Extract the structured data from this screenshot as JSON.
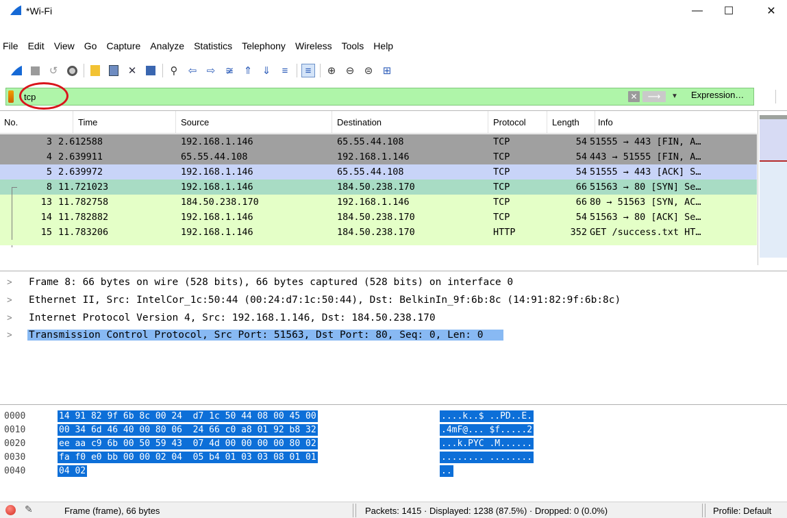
{
  "window": {
    "title": "*Wi-Fi",
    "minimize": "—",
    "maximize": "☐",
    "close": "✕"
  },
  "menu": [
    "File",
    "Edit",
    "View",
    "Go",
    "Capture",
    "Analyze",
    "Statistics",
    "Telephony",
    "Wireless",
    "Tools",
    "Help"
  ],
  "toolbar": {
    "icons": [
      "shark-fin-icon",
      "stop-icon",
      "restart-icon",
      "capture-options-icon",
      "open-file-icon",
      "save-file-icon",
      "close-file-icon",
      "reload-icon",
      "find-packet-icon",
      "go-back-icon",
      "go-forward-icon",
      "go-to-packet-icon",
      "go-first-icon",
      "go-last-icon",
      "autoscroll-icon",
      "colorize-icon",
      "zoom-in-icon",
      "zoom-out-icon",
      "zoom-normal-icon",
      "resize-columns-icon"
    ]
  },
  "filter": {
    "value": "tcp",
    "expression_label": "Expression…",
    "clear_label": "✕",
    "apply_label": "⟶"
  },
  "packet_list": {
    "columns": [
      "No.",
      "Time",
      "Source",
      "Destination",
      "Protocol",
      "Length",
      "Info"
    ],
    "rows": [
      {
        "no": "3",
        "time": "2.612588",
        "src": "192.168.1.146",
        "dst": "65.55.44.108",
        "proto": "TCP",
        "len": "54",
        "info": "51555 → 443 [FIN, A…",
        "bg": "#a0a0a0"
      },
      {
        "no": "4",
        "time": "2.639911",
        "src": "65.55.44.108",
        "dst": "192.168.1.146",
        "proto": "TCP",
        "len": "54",
        "info": "443 → 51555 [FIN, A…",
        "bg": "#a0a0a0"
      },
      {
        "no": "5",
        "time": "2.639972",
        "src": "192.168.1.146",
        "dst": "65.55.44.108",
        "proto": "TCP",
        "len": "54",
        "info": "51555 → 443 [ACK] S…",
        "bg": "#c8d4f8"
      },
      {
        "no": "8",
        "time": "11.721023",
        "src": "192.168.1.146",
        "dst": "184.50.238.170",
        "proto": "TCP",
        "len": "66",
        "info": "51563 → 80 [SYN] Se…",
        "bg": "#a8dcc4"
      },
      {
        "no": "13",
        "time": "11.782758",
        "src": "184.50.238.170",
        "dst": "192.168.1.146",
        "proto": "TCP",
        "len": "66",
        "info": "80 → 51563 [SYN, AC…",
        "bg": "#e4ffc7"
      },
      {
        "no": "14",
        "time": "11.782882",
        "src": "192.168.1.146",
        "dst": "184.50.238.170",
        "proto": "TCP",
        "len": "54",
        "info": "51563 → 80 [ACK] Se…",
        "bg": "#e4ffc7"
      },
      {
        "no": "15",
        "time": "11.783206",
        "src": "192.168.1.146",
        "dst": "184.50.238.170",
        "proto": "HTTP",
        "len": "352",
        "info": "GET /success.txt HT…",
        "bg": "#e4ffc7"
      }
    ]
  },
  "details": [
    "Frame 8: 66 bytes on wire (528 bits), 66 bytes captured (528 bits) on interface 0",
    "Ethernet II, Src: IntelCor_1c:50:44 (00:24:d7:1c:50:44), Dst: BelkinIn_9f:6b:8c (14:91:82:9f:6b:8c)",
    "Internet Protocol Version 4, Src: 192.168.1.146, Dst: 184.50.238.170",
    "Transmission Control Protocol, Src Port: 51563, Dst Port: 80, Seq: 0, Len: 0"
  ],
  "bytes": [
    {
      "offset": "0000",
      "hex": "14 91 82 9f 6b 8c 00 24  d7 1c 50 44 08 00 45 00",
      "ascii": "....k..$ ..PD..E."
    },
    {
      "offset": "0010",
      "hex": "00 34 6d 46 40 00 80 06  24 66 c0 a8 01 92 b8 32",
      "ascii": ".4mF@... $f.....2"
    },
    {
      "offset": "0020",
      "hex": "ee aa c9 6b 00 50 59 43  07 4d 00 00 00 00 80 02",
      "ascii": "...k.PYC .M......"
    },
    {
      "offset": "0030",
      "hex": "fa f0 e0 bb 00 00 02 04  05 b4 01 03 03 08 01 01",
      "ascii": "........ ........"
    },
    {
      "offset": "0040",
      "hex": "04 02",
      "ascii": ".."
    }
  ],
  "status": {
    "frame": "Frame (frame), 66 bytes",
    "packets": "Packets: 1415 · Displayed: 1238 (87.5%) · Dropped: 0 (0.0%)",
    "profile": "Profile: Default"
  }
}
